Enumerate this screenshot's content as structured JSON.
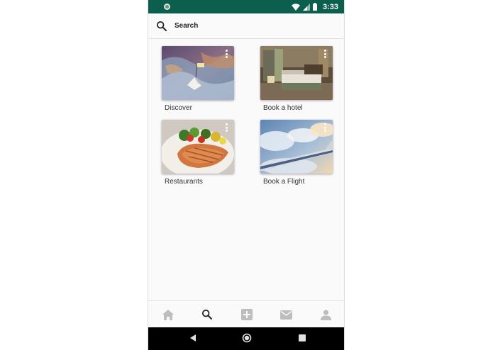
{
  "status_bar": {
    "time": "3:33"
  },
  "search": {
    "label": "Search"
  },
  "categories": [
    {
      "label": "Discover"
    },
    {
      "label": "Book a hotel"
    },
    {
      "label": "Restaurants"
    },
    {
      "label": "Book a Flight"
    }
  ],
  "bottom_nav": {
    "items": [
      "home-icon",
      "search-icon",
      "add-icon",
      "mail-icon",
      "profile-icon"
    ],
    "active": "search-icon"
  },
  "colors": {
    "status_bar": "#0d5f4d",
    "nav_inactive": "#bdbdbd",
    "nav_active": "#212121"
  }
}
